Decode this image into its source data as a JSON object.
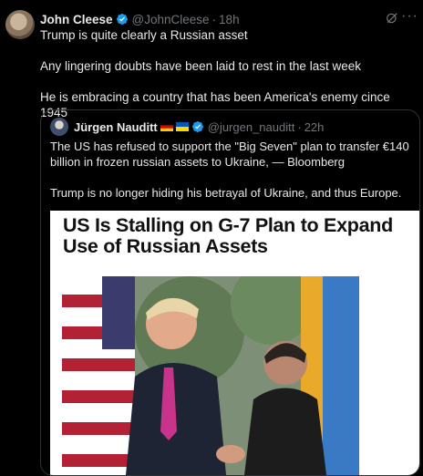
{
  "tweet": {
    "author_name": "John Cleese",
    "handle": "@JohnCleese",
    "separator": "·",
    "time": "18h",
    "lines": [
      "Trump is quite clearly a Russian asset",
      "Any lingering doubts have been laid to rest in the last week",
      "He is embracing a country that has been America's enemy cince 1945"
    ]
  },
  "quote": {
    "author_name": "Jürgen Nauditt",
    "handle": "@jurgen_nauditt",
    "separator": "·",
    "time": "22h",
    "lines": [
      "The US has refused to support the \"Big Seven\" plan to transfer €140 billion in frozen russian assets to Ukraine, — Bloomberg",
      "Trump is no longer hiding his betrayal of Ukraine, and thus Europe."
    ],
    "article_headline": "US Is Stalling on G-7 Plan to Expand Use of Russian Assets"
  },
  "icons": {
    "verified": "verified-badge-icon",
    "grok": "grok-icon",
    "more": "more-icon",
    "flags": [
      "germany-flag-icon",
      "ukraine-flag-icon"
    ]
  },
  "colors": {
    "verified_blue": "#1d9bf0",
    "muted": "#71767b",
    "border": "#2f3336"
  }
}
